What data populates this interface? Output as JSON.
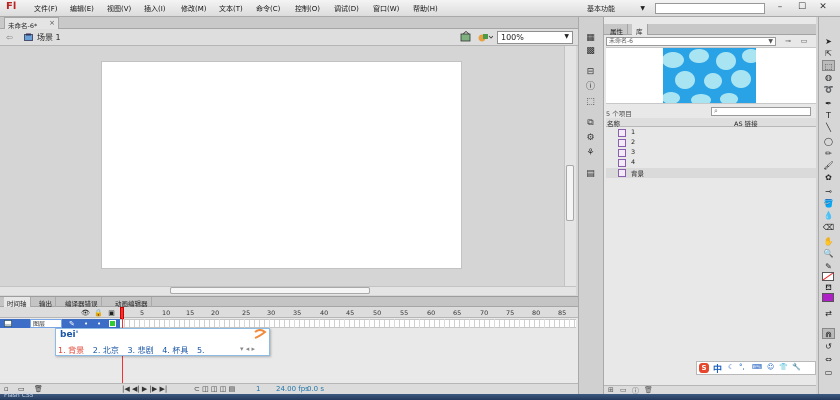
{
  "app": {
    "logo": "Fl",
    "menu": [
      "文件(F)",
      "编辑(E)",
      "视图(V)",
      "插入(I)",
      "修改(M)",
      "文本(T)",
      "命令(C)",
      "控制(O)",
      "调试(D)",
      "窗口(W)",
      "帮助(H)"
    ],
    "workspace": "基本功能",
    "window_controls": [
      "–",
      "☐",
      "✕"
    ]
  },
  "document": {
    "tab_label": "未命名-6*",
    "scene": "场景 1",
    "zoom": "100%"
  },
  "timeline": {
    "tabs": [
      "时间轴",
      "输出",
      "编译器错误",
      "动画编辑器"
    ],
    "frame_numbers": [
      "1",
      "5",
      "10",
      "15",
      "20",
      "25",
      "30",
      "35",
      "40",
      "45",
      "50",
      "55",
      "60",
      "65",
      "70",
      "75",
      "80",
      "85"
    ],
    "layer_name_value": "图层",
    "status": {
      "current_frame": "1",
      "fps": "24.00 fps",
      "time": "0.0 s"
    }
  },
  "ime": {
    "input": "bei'",
    "candidates": [
      "1. 背景",
      "2. 北京",
      "3. 悲剧",
      "4. 杯具",
      "5. "
    ],
    "bar_label": "中"
  },
  "library": {
    "tabs": [
      "属性",
      "库"
    ],
    "doc_select": "未命名-6",
    "item_count": "5 个项目",
    "columns": {
      "name": "名称",
      "linkage": "AS 链接"
    },
    "items": [
      "1",
      "2",
      "3",
      "4",
      "背景"
    ],
    "selected_index": 4,
    "preview_colors": {
      "bg": "#2aa3e6",
      "spot": "#a9e4f2"
    }
  },
  "taskbar": {
    "text": "Flash CS5"
  },
  "colors": {
    "stroke": "#ffffff",
    "fill": "#b020c8",
    "accent": "#3c6ec8"
  }
}
